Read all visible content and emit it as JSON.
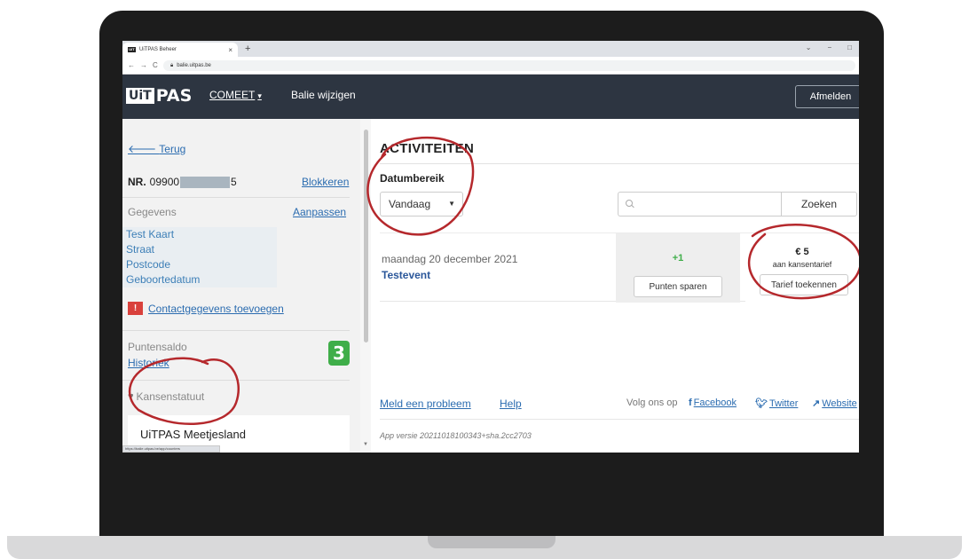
{
  "browser": {
    "tab_title": "UiTPAS Beheer",
    "tab_close": "×",
    "new_tab": "+",
    "url": "balie.uitpas.be",
    "status_url": "https://balie.uitpas.be/app/counters",
    "window_controls": [
      "⌄",
      "−",
      "□"
    ]
  },
  "header": {
    "logo_part1": "UiT",
    "logo_part2": "PAS",
    "counter_menu": "COMEET",
    "switch_counter": "Balie wijzigen",
    "logout": "Afmelden"
  },
  "sidebar": {
    "back": "Terug",
    "nr_label": "NR.",
    "nr_prefix": "09900",
    "nr_suffix": "5",
    "block": "Blokkeren",
    "details_label": "Gegevens",
    "edit": "Aanpassen",
    "details": [
      "Test Kaart",
      "Straat",
      "Postcode",
      "Geboortedatum"
    ],
    "add_contact": "Contactgegevens toevoegen",
    "points_label": "Puntensaldo",
    "points_value": "3",
    "history": "Historiek",
    "status_label": "Kansenstatuut",
    "organization": "UiTPAS Meetjesland"
  },
  "main": {
    "title": "ACTIVITEITEN",
    "date_range_label": "Datumbereik",
    "date_range_value": "Vandaag",
    "search_placeholder": "",
    "search_button": "Zoeken",
    "activity": {
      "date": "maandag 20 december 2021",
      "name": "Testevent",
      "points": "+1",
      "save_points": "Punten sparen",
      "price": "€ 5",
      "price_note": "aan kansentarief",
      "assign_tariff": "Tarief toekennen"
    },
    "footer": {
      "report": "Meld een probleem",
      "help": "Help",
      "follow": "Volg ons op",
      "facebook": "Facebook",
      "twitter": "Twitter",
      "website": "Website",
      "version": "App versie 20211018100343+sha.2cc2703"
    }
  },
  "colors": {
    "header_bg": "#2d3541",
    "link": "#2b6cb0",
    "badge_green": "#3fae49",
    "warning_red": "#d9413c",
    "annotation_red": "#b5282c"
  }
}
